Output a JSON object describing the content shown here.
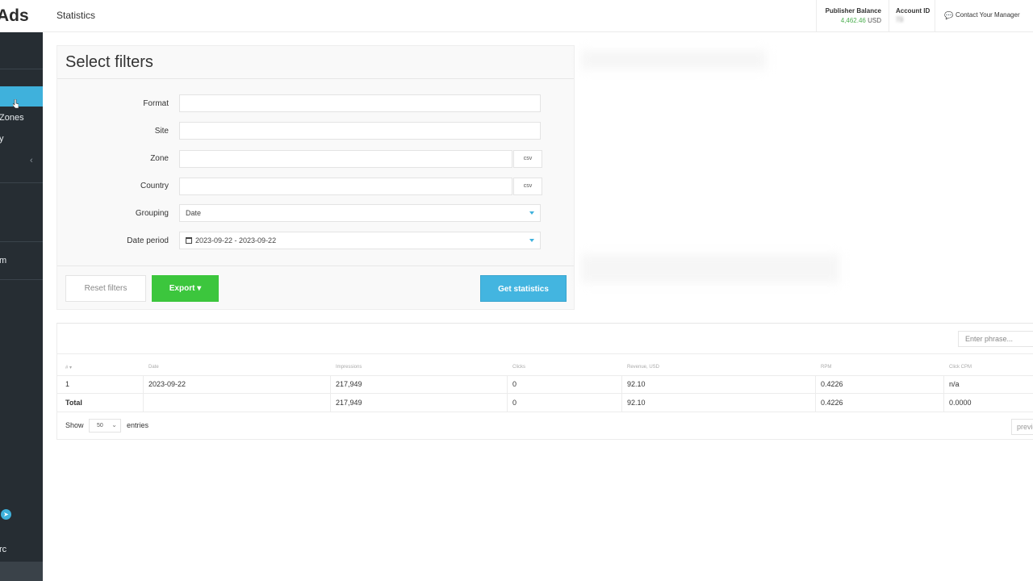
{
  "brand": {
    "logo_text": "Ads"
  },
  "sidebar": {
    "items": [
      {
        "label": "Zones"
      },
      {
        "label": "y"
      },
      {
        "label": "m"
      },
      {
        "label": "rc"
      }
    ],
    "collapse_icon": "chevron-left-icon",
    "telegram_icon": "telegram-icon"
  },
  "header": {
    "title": "Statistics",
    "balance_label": "Publisher Balance",
    "balance_value": "4,462.46",
    "balance_currency": "USD",
    "account_label": "Account ID",
    "account_value": "73",
    "contact_label": "Contact Your Manager"
  },
  "filters": {
    "title": "Select filters",
    "format_label": "Format",
    "site_label": "Site",
    "zone_label": "Zone",
    "country_label": "Country",
    "csv_label": "csv",
    "grouping_label": "Grouping",
    "grouping_value": "Date",
    "period_label": "Date period",
    "period_value": "2023-09-22 - 2023-09-22",
    "reset_label": "Reset filters",
    "export_label": "Export ▾",
    "get_label": "Get statistics"
  },
  "table": {
    "search_placeholder": "Enter phrase...",
    "columns": [
      "# ▾",
      "Date",
      "Impressions",
      "Clicks",
      "Revenue, USD",
      "RPM",
      "Click CPM"
    ],
    "rows": [
      [
        "1",
        "2023-09-22",
        "217,949",
        "0",
        "92.10",
        "0.4226",
        "n/a"
      ]
    ],
    "total": [
      "Total",
      "",
      "217,949",
      "0",
      "92.10",
      "0.4226",
      "0.0000"
    ],
    "show_label": "Show",
    "page_size": "50",
    "entries_label": "entries",
    "prev_label": "previous"
  },
  "colors": {
    "accent": "#3fb1dc",
    "export": "#3cc63d",
    "balance": "#4caf50",
    "sidebar": "#262d33"
  }
}
